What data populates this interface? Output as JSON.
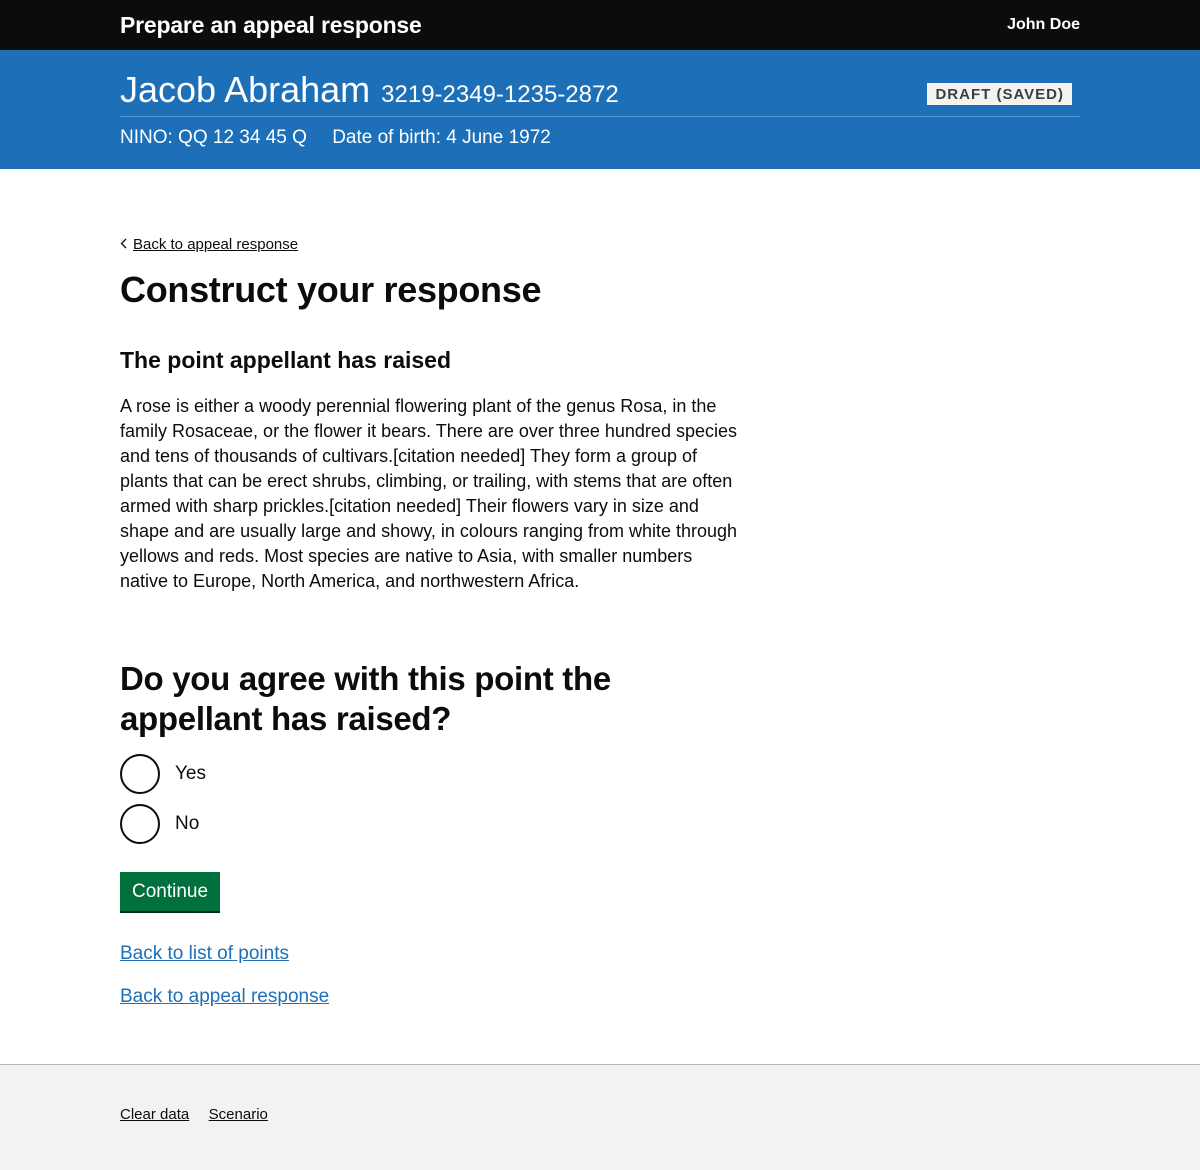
{
  "header": {
    "service_name": "Prepare an appeal response",
    "user_name": "John Doe"
  },
  "banner": {
    "person_name": "Jacob Abraham",
    "reference": "3219-2349-1235-2872",
    "status_tag": "DRAFT (SAVED)",
    "nino": "NINO: QQ 12 34 45 Q",
    "dob": "Date of birth: 4 June 1972"
  },
  "main": {
    "back_link": "Back to appeal response",
    "title": "Construct your response",
    "point_heading": "The point appellant has raised",
    "point_body": "A rose is either a woody perennial flowering plant of the genus Rosa, in the family Rosaceae, or the flower it bears. There are over three hundred species and tens of thousands of cultivars.[citation needed] They form a group of plants that can be erect shrubs, climbing, or trailing, with stems that are often armed with sharp prickles.[citation needed] Their flowers vary in size and shape and are usually large and showy, in colours ranging from white through yellows and reds. Most species are native to Asia, with smaller numbers native to Europe, North America, and northwestern Africa.",
    "question": "Do you agree with this point the appellant has raised?",
    "options": [
      {
        "label": "Yes"
      },
      {
        "label": "No"
      }
    ],
    "continue_label": "Continue",
    "links": [
      "Back to list of points",
      "Back to appeal response"
    ]
  },
  "footer": {
    "links": [
      "Clear data",
      "Scenario"
    ]
  },
  "colors": {
    "header_bg": "#0b0c0c",
    "banner_bg": "#1d70b8",
    "button_green": "#00703c",
    "link_blue": "#1d70b8",
    "footer_bg": "#f3f2f1"
  }
}
